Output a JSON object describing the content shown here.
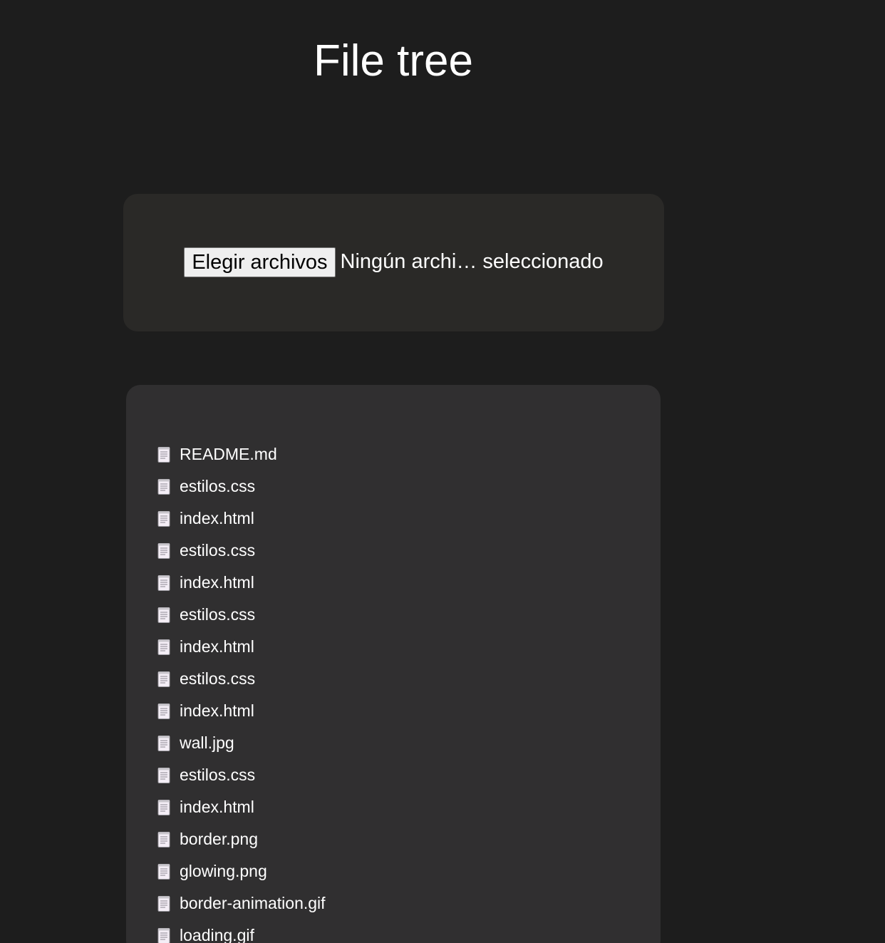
{
  "page": {
    "title": "File tree"
  },
  "upload": {
    "button_label": "Elegir archivos",
    "status_text": "Ningún archi… seleccionado"
  },
  "icons": {
    "file": "document-icon"
  },
  "files": [
    "README.md",
    "estilos.css",
    "index.html",
    "estilos.css",
    "index.html",
    "estilos.css",
    "index.html",
    "estilos.css",
    "index.html",
    "wall.jpg",
    "estilos.css",
    "index.html",
    "border.png",
    "glowing.png",
    "border-animation.gif",
    "loading.gif"
  ]
}
